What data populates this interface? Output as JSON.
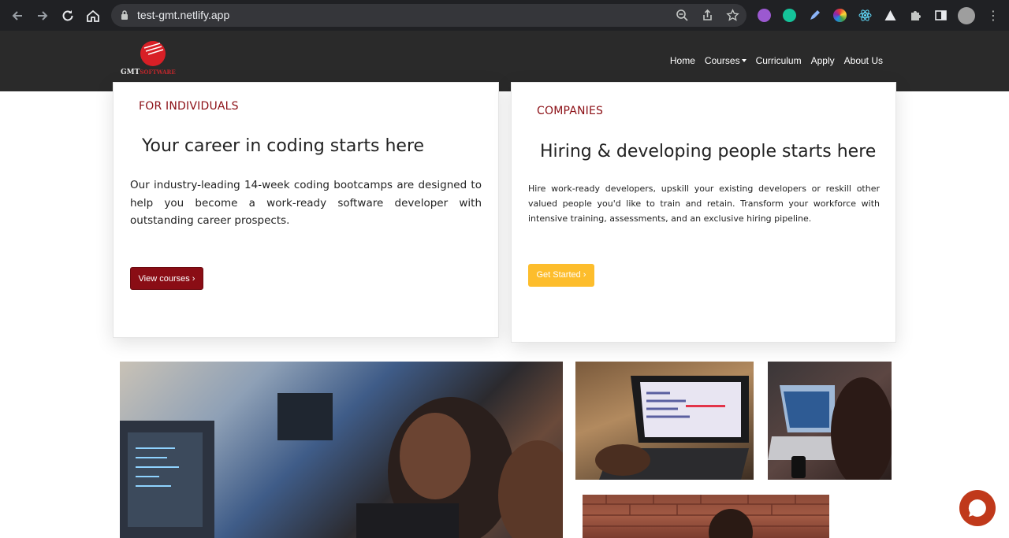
{
  "browser": {
    "url": "test-gmt.netlify.app"
  },
  "navbar": {
    "logo_main": "GMT",
    "logo_sub": "SOFTWARE",
    "links": [
      {
        "label": "Home"
      },
      {
        "label": "Courses"
      },
      {
        "label": "Curriculum"
      },
      {
        "label": "Apply"
      },
      {
        "label": "About Us"
      }
    ]
  },
  "individuals": {
    "eyebrow": "FOR INDIVIDUALS",
    "heading": "Your career in coding starts here",
    "body": "Our industry-leading 14-week coding bootcamps are designed to help you become a work-ready software developer with outstanding career prospects.",
    "button": "View courses ›"
  },
  "companies": {
    "eyebrow": "COMPANIES",
    "heading": "Hiring & developing people starts here",
    "body": "Hire work-ready developers, upskill your existing developers or reskill other valued people you'd like to train and retain. Transform your workforce with intensive training, assessments, and an exclusive hiring pipeline.",
    "button": "Get Started ›"
  },
  "colors": {
    "accent_red": "#8a0d15",
    "accent_yellow": "#fdbd2c",
    "navbar_bg": "#2a2a2a",
    "chat_bubble": "#c0391b"
  },
  "icons": [
    "back-arrow-icon",
    "forward-arrow-icon",
    "reload-icon",
    "home-icon",
    "lock-icon",
    "zoom-icon",
    "share-icon",
    "star-icon",
    "puzzle-icon",
    "chat-bubble-icon"
  ]
}
